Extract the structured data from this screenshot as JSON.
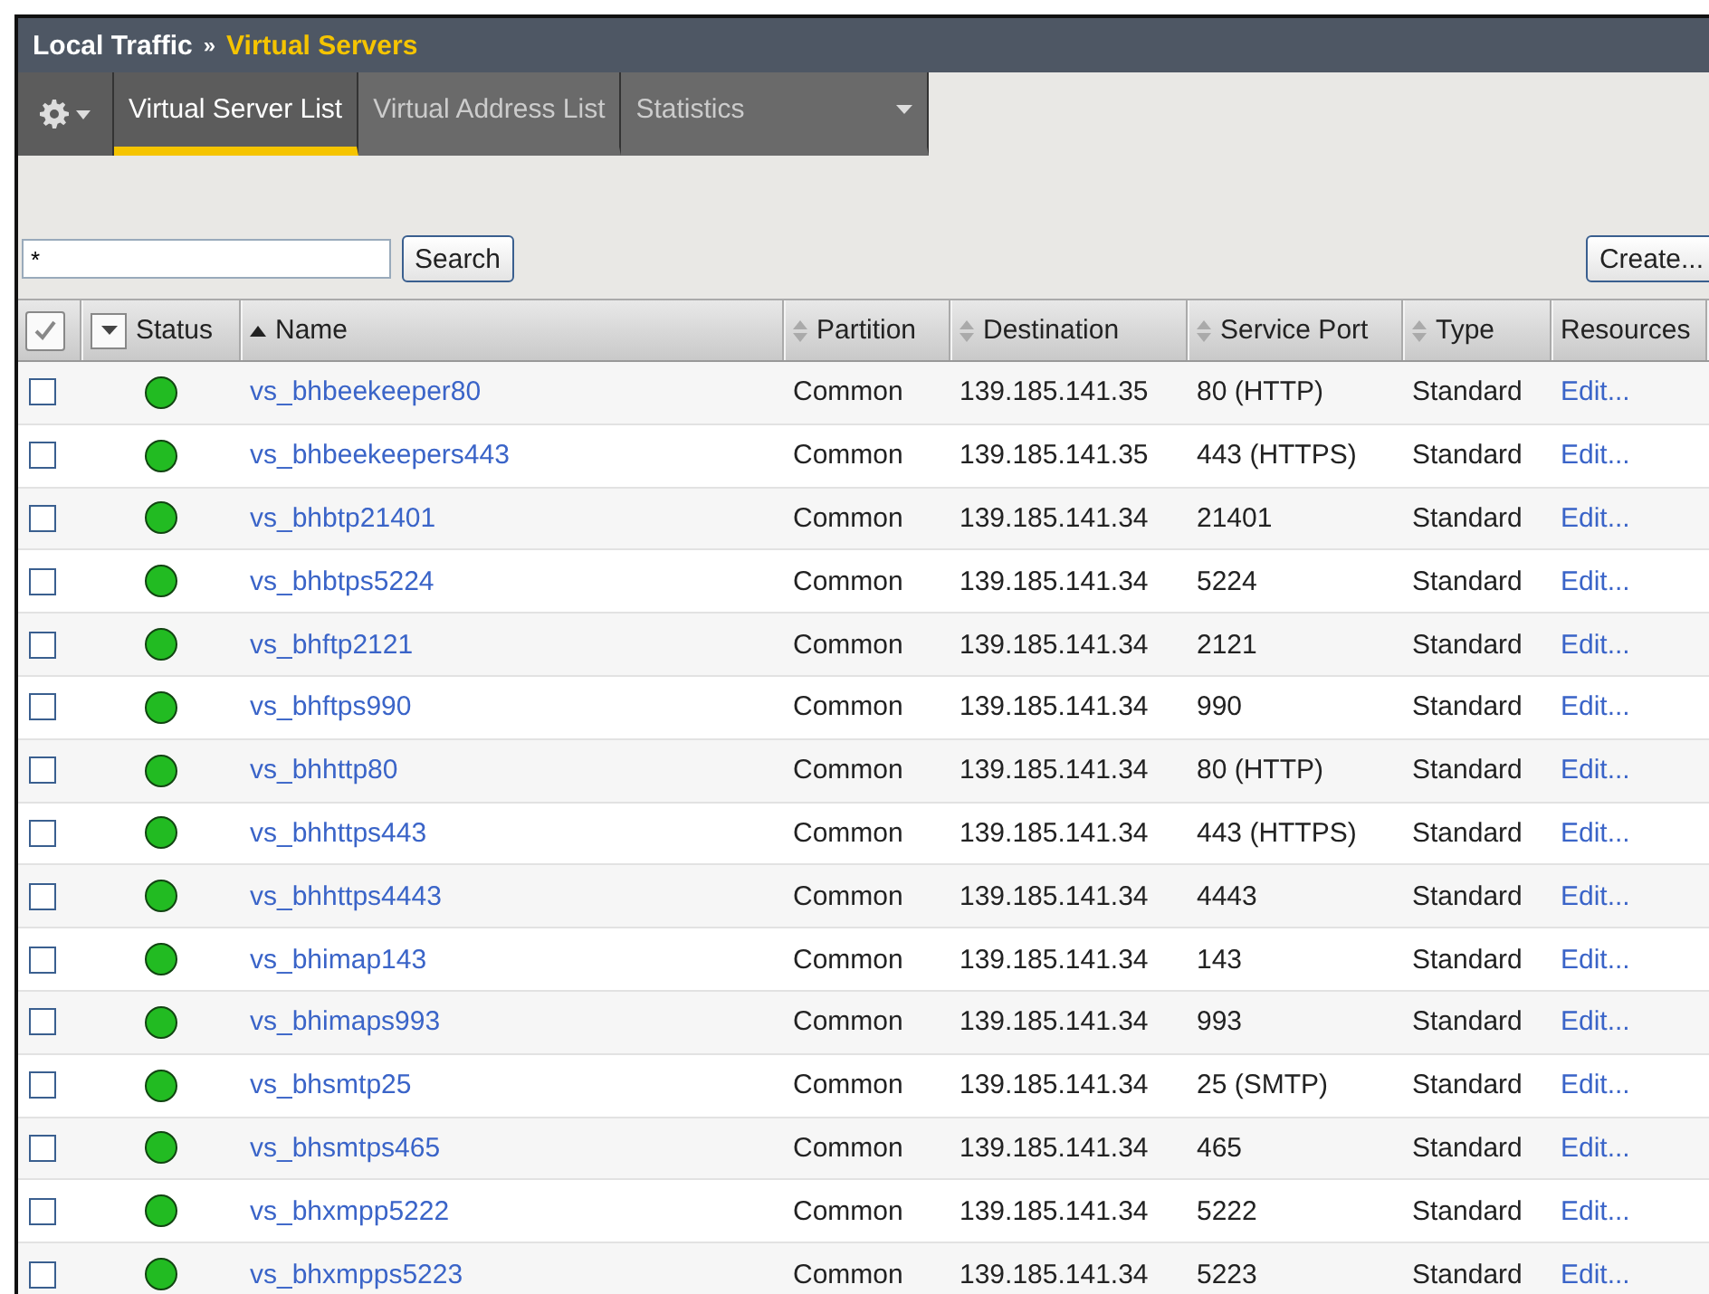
{
  "breadcrumb": {
    "section": "Local Traffic",
    "separator": "»",
    "page": "Virtual Servers"
  },
  "tabs": [
    {
      "label": "Virtual Server List",
      "selected": true,
      "dropdown": false
    },
    {
      "label": "Virtual Address List",
      "selected": false,
      "dropdown": false
    },
    {
      "label": "Statistics",
      "selected": false,
      "dropdown": true
    }
  ],
  "search": {
    "value": "*",
    "button": "Search"
  },
  "create_button": "Create...",
  "table": {
    "select_all_checked": true,
    "columns": [
      {
        "label": "Status",
        "kind": "menu"
      },
      {
        "label": "Name",
        "kind": "ascending"
      },
      {
        "label": "Partition",
        "kind": "sortable"
      },
      {
        "label": "Destination",
        "kind": "sortable"
      },
      {
        "label": "Service Port",
        "kind": "sortable"
      },
      {
        "label": "Type",
        "kind": "sortable"
      },
      {
        "label": "Resources",
        "kind": "plain"
      }
    ],
    "rows": [
      {
        "checked": false,
        "color": "#22bb22",
        "name": "vs_bhbeekeeper80",
        "partition": "Common",
        "destination": "139.185.141.35",
        "port": "80 (HTTP)",
        "type": "Standard",
        "resources": "Edit..."
      },
      {
        "checked": false,
        "color": "#22bb22",
        "name": "vs_bhbeekeepers443",
        "partition": "Common",
        "destination": "139.185.141.35",
        "port": "443 (HTTPS)",
        "type": "Standard",
        "resources": "Edit..."
      },
      {
        "checked": false,
        "color": "#22bb22",
        "name": "vs_bhbtp21401",
        "partition": "Common",
        "destination": "139.185.141.34",
        "port": "21401",
        "type": "Standard",
        "resources": "Edit..."
      },
      {
        "checked": false,
        "color": "#22bb22",
        "name": "vs_bhbtps5224",
        "partition": "Common",
        "destination": "139.185.141.34",
        "port": "5224",
        "type": "Standard",
        "resources": "Edit..."
      },
      {
        "checked": false,
        "color": "#22bb22",
        "name": "vs_bhftp2121",
        "partition": "Common",
        "destination": "139.185.141.34",
        "port": "2121",
        "type": "Standard",
        "resources": "Edit..."
      },
      {
        "checked": false,
        "color": "#22bb22",
        "name": "vs_bhftps990",
        "partition": "Common",
        "destination": "139.185.141.34",
        "port": "990",
        "type": "Standard",
        "resources": "Edit..."
      },
      {
        "checked": false,
        "color": "#22bb22",
        "name": "vs_bhhttp80",
        "partition": "Common",
        "destination": "139.185.141.34",
        "port": "80 (HTTP)",
        "type": "Standard",
        "resources": "Edit..."
      },
      {
        "checked": false,
        "color": "#22bb22",
        "name": "vs_bhhttps443",
        "partition": "Common",
        "destination": "139.185.141.34",
        "port": "443 (HTTPS)",
        "type": "Standard",
        "resources": "Edit..."
      },
      {
        "checked": false,
        "color": "#22bb22",
        "name": "vs_bhhttps4443",
        "partition": "Common",
        "destination": "139.185.141.34",
        "port": "4443",
        "type": "Standard",
        "resources": "Edit..."
      },
      {
        "checked": false,
        "color": "#22bb22",
        "name": "vs_bhimap143",
        "partition": "Common",
        "destination": "139.185.141.34",
        "port": "143",
        "type": "Standard",
        "resources": "Edit..."
      },
      {
        "checked": false,
        "color": "#22bb22",
        "name": "vs_bhimaps993",
        "partition": "Common",
        "destination": "139.185.141.34",
        "port": "993",
        "type": "Standard",
        "resources": "Edit..."
      },
      {
        "checked": false,
        "color": "#22bb22",
        "name": "vs_bhsmtp25",
        "partition": "Common",
        "destination": "139.185.141.34",
        "port": "25 (SMTP)",
        "type": "Standard",
        "resources": "Edit..."
      },
      {
        "checked": false,
        "color": "#22bb22",
        "name": "vs_bhsmtps465",
        "partition": "Common",
        "destination": "139.185.141.34",
        "port": "465",
        "type": "Standard",
        "resources": "Edit..."
      },
      {
        "checked": false,
        "color": "#22bb22",
        "name": "vs_bhxmpp5222",
        "partition": "Common",
        "destination": "139.185.141.34",
        "port": "5222",
        "type": "Standard",
        "resources": "Edit..."
      },
      {
        "checked": false,
        "color": "#22bb22",
        "name": "vs_bhxmpps5223",
        "partition": "Common",
        "destination": "139.185.141.34",
        "port": "5223",
        "type": "Standard",
        "resources": "Edit..."
      }
    ]
  }
}
